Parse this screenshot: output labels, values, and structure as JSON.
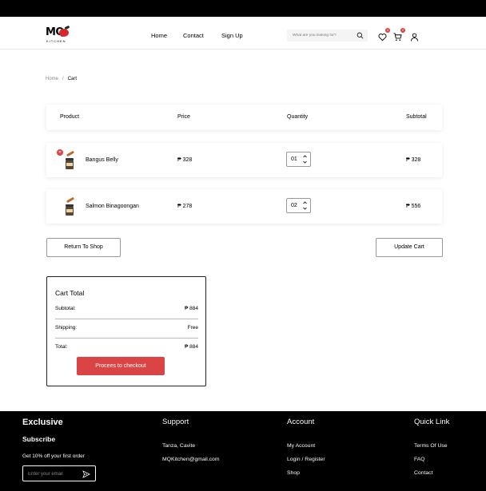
{
  "header": {
    "logo": {
      "text": "MQ",
      "subtext": "KITCHEN"
    },
    "nav": [
      "Home",
      "Contact",
      "Sign Up"
    ],
    "search_placeholder": "What are you looking for?",
    "wishlist_count": "4",
    "cart_count": "2"
  },
  "breadcrumb": {
    "home": "Home",
    "separator": "/",
    "current": "Cart"
  },
  "table": {
    "headers": [
      "Product",
      "Price",
      "Quantity",
      "Subtotal"
    ],
    "rows": [
      {
        "name": "Bangus Belly",
        "price": "₱ 328",
        "quantity": "01",
        "subtotal": "₱ 328"
      },
      {
        "name": "Salmon Binagoongan",
        "price": "₱ 278",
        "quantity": "02",
        "subtotal": "₱  556"
      }
    ]
  },
  "actions": {
    "return": "Return To Shop",
    "update": "Update Cart"
  },
  "cart_total": {
    "title": "Cart Total",
    "subtotal_label": "Subtotal:",
    "subtotal_value": "₱ 884",
    "shipping_label": "Shipping:",
    "shipping_value": "Free",
    "total_label": "Total:",
    "total_value": "₱ 884",
    "checkout": "Procees to checkout"
  },
  "footer": {
    "exclusive": {
      "title": "Exclusive",
      "subscribe": "Subscribe",
      "offer": "Get 10% off your first order",
      "email_placeholder": "Enter your email"
    },
    "support": {
      "title": "Support",
      "links": [
        "Tanza, Cavite",
        "MQKitchen@gmail.com"
      ]
    },
    "account": {
      "title": "Account",
      "links": [
        "My Account",
        "Login / Register",
        "Shop"
      ]
    },
    "quick_link": {
      "title": "Quick Link",
      "links": [
        "Terms Of Use",
        "FAQ",
        "Contact"
      ]
    }
  },
  "colors": {
    "accent": "#DB4444",
    "footer_bg": "#000000",
    "text": "#000000"
  },
  "icons": [
    "search-icon",
    "heart-icon",
    "cart-icon",
    "user-icon",
    "remove-icon",
    "chevron-up-icon",
    "chevron-down-icon",
    "send-icon"
  ]
}
